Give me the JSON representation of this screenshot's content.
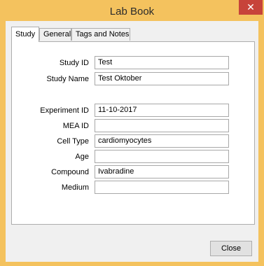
{
  "window": {
    "title": "Lab Book",
    "close_glyph": "✕"
  },
  "tabs": [
    {
      "label": "Study",
      "active": true
    },
    {
      "label": "General",
      "active": false
    },
    {
      "label": "Tags and Notes",
      "active": false
    }
  ],
  "form": {
    "study_id": {
      "label": "Study ID",
      "value": "Test"
    },
    "study_name": {
      "label": "Study Name",
      "value": "Test Oktober"
    },
    "experiment_id": {
      "label": "Experiment ID",
      "value": "11-10-2017"
    },
    "mea_id": {
      "label": "MEA ID",
      "value": ""
    },
    "cell_type": {
      "label": "Cell Type",
      "value": "cardiomyocytes"
    },
    "age": {
      "label": "Age",
      "value": ""
    },
    "compound": {
      "label": "Compound",
      "value": "Ivabradine"
    },
    "medium": {
      "label": "Medium",
      "value": ""
    }
  },
  "buttons": {
    "close": "Close"
  },
  "colors": {
    "frame": "#f4c25e",
    "close_button": "#c7433a"
  }
}
